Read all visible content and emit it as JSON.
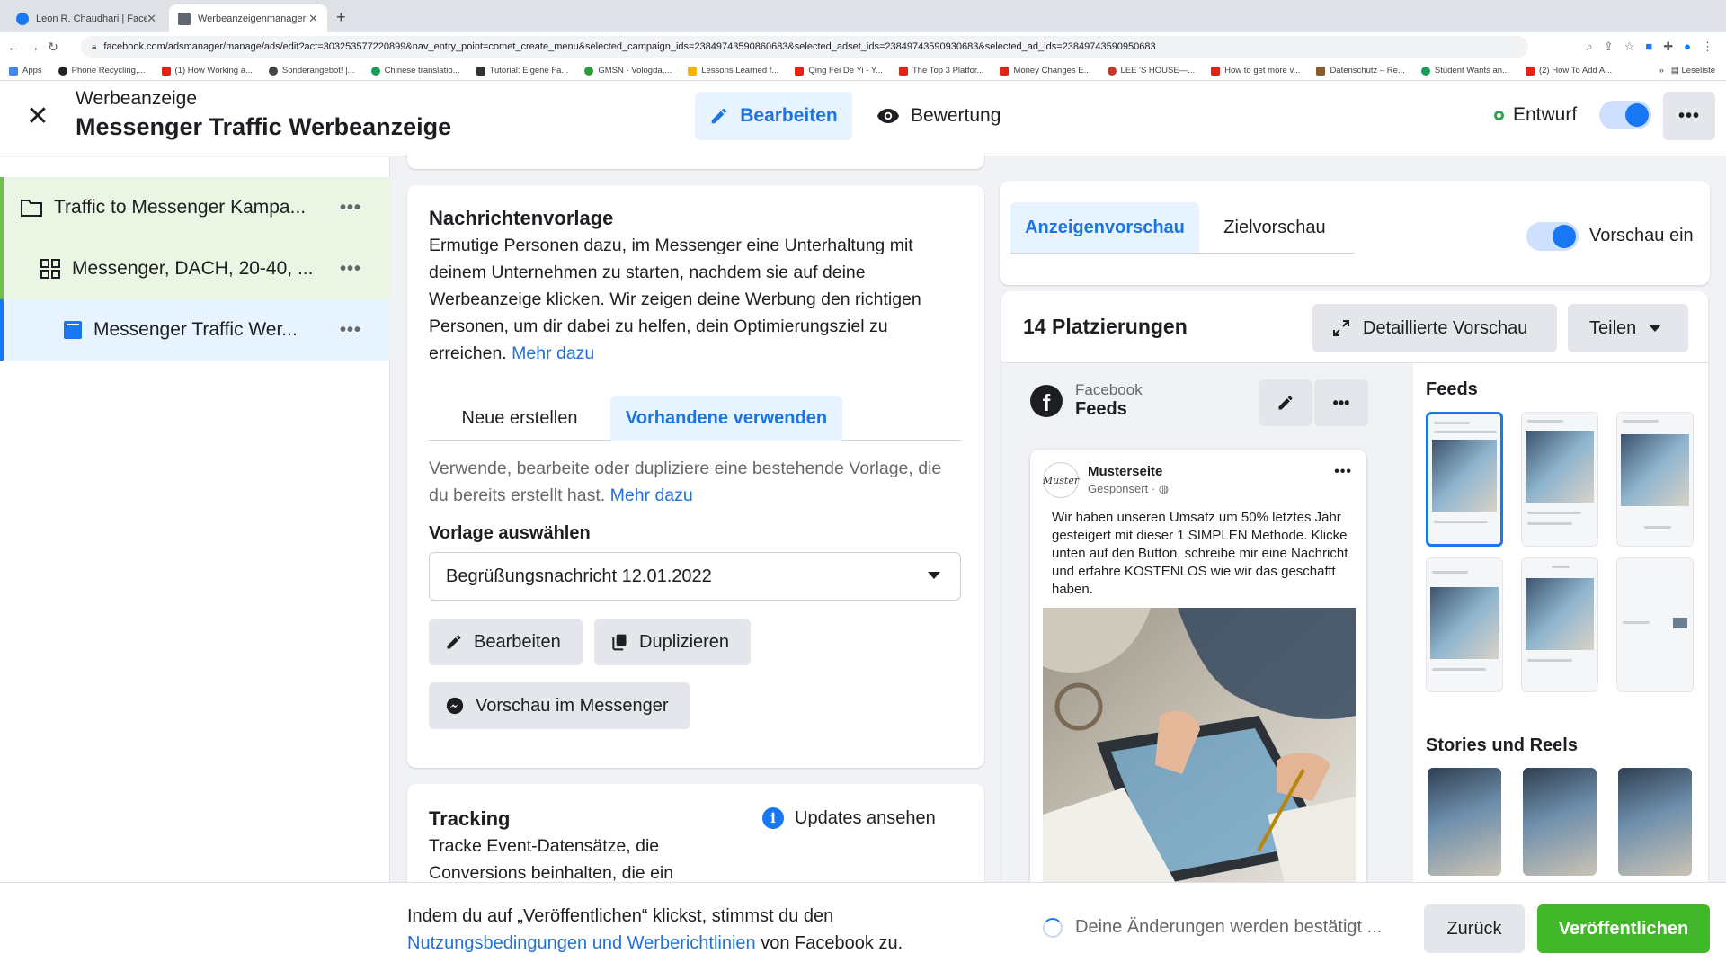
{
  "browser": {
    "tabs": [
      {
        "title": "Leon R. Chaudhari | Facebook",
        "active": false
      },
      {
        "title": "Werbeanzeigenmanager - We",
        "active": true
      }
    ],
    "url": "facebook.com/adsmanager/manage/ads/edit?act=303253577220899&nav_entry_point=comet_create_menu&selected_campaign_ids=23849743590860683&selected_adset_ids=23849743590930683&selected_ad_ids=23849743590950683",
    "bookmarks": [
      "Apps",
      "Phone Recycling,...",
      "(1) How Working a...",
      "Sonderangebot! |...",
      "Chinese translatio...",
      "Tutorial: Eigene Fa...",
      "GMSN - Vologda,...",
      "Lessons Learned f...",
      "Qing Fei De Yi - Y...",
      "The Top 3 Platfor...",
      "Money Changes E...",
      "LEE 'S HOUSE—...",
      "How to get more v...",
      "Datenschutz – Re...",
      "Student Wants an...",
      "(2) How To Add A..."
    ],
    "reading_list": "Leseliste",
    "more_bookmarks": "»"
  },
  "header": {
    "subtitle": "Werbeanzeige",
    "title": "Messenger Traffic Werbeanzeige",
    "edit_label": "Bearbeiten",
    "review_label": "Bewertung",
    "status_label": "Entwurf"
  },
  "sidebar": {
    "items": [
      {
        "label": "Traffic to Messenger Kampa...",
        "more": "•••"
      },
      {
        "label": "Messenger, DACH, 20-40, ...",
        "more": "•••"
      },
      {
        "label": "Messenger Traffic Wer...",
        "more": "•••"
      }
    ]
  },
  "message_template": {
    "title": "Nachrichtenvorlage",
    "description": "Ermutige Personen dazu, im Messenger eine Unterhaltung mit deinem Unternehmen zu starten, nachdem sie auf deine Werbeanzeige klicken. Wir zeigen deine Werbung den richtigen Personen, um dir dabei zu helfen, dein Optimierungsziel zu erreichen.",
    "learn_more": "Mehr dazu",
    "tab_new": "Neue erstellen",
    "tab_existing": "Vorhandene verwenden",
    "existing_desc": "Verwende, bearbeite oder dupliziere eine bestehende Vorlage, die du bereits erstellt hast.",
    "existing_learn_more": "Mehr dazu",
    "select_label": "Vorlage auswählen",
    "selected_template": "Begrüßungsnachricht 12.01.2022",
    "edit_button": "Bearbeiten",
    "duplicate_button": "Duplizieren",
    "preview_button": "Vorschau im Messenger"
  },
  "tracking": {
    "title": "Tracking",
    "description": "Tracke Event-Datensätze, die Conversions beinhalten, die ein",
    "updates_label": "Updates ansehen"
  },
  "preview": {
    "tab_ad": "Anzeigenvorschau",
    "tab_target": "Zielvorschau",
    "toggle_label": "Vorschau ein",
    "placements_title": "14 Platzierungen",
    "detail_button": "Detaillierte Vorschau",
    "share_button": "Teilen",
    "platform": "Facebook",
    "placement": "Feeds",
    "post": {
      "page_name": "Musterseite",
      "sponsored": "Gesponsert · ◍",
      "avatar_text": "Muster",
      "text": "Wir haben unseren Umsatz um 50% letztes Jahr gesteigert mit dieser 1 SIMPLEN Methode. Klicke unten auf den Button, schreibe mir eine Nachricht und erfahre KOSTENLOS wie wir das geschafft haben."
    },
    "feeds_title": "Feeds",
    "stories_title": "Stories und Reels"
  },
  "bottom": {
    "consent_prefix": "Indem du auf „Veröffentlichen“ klickst, stimmst du den",
    "consent_link": "Nutzungsbedingungen und Werberichtlinien",
    "consent_suffix": "von Facebook zu.",
    "status": "Deine Änderungen werden bestätigt ...",
    "back_button": "Zurück",
    "publish_button": "Veröffentlichen"
  },
  "colors": {
    "accent": "#1877f2",
    "publish_green": "#42b72a",
    "status_green": "#31a24c"
  }
}
